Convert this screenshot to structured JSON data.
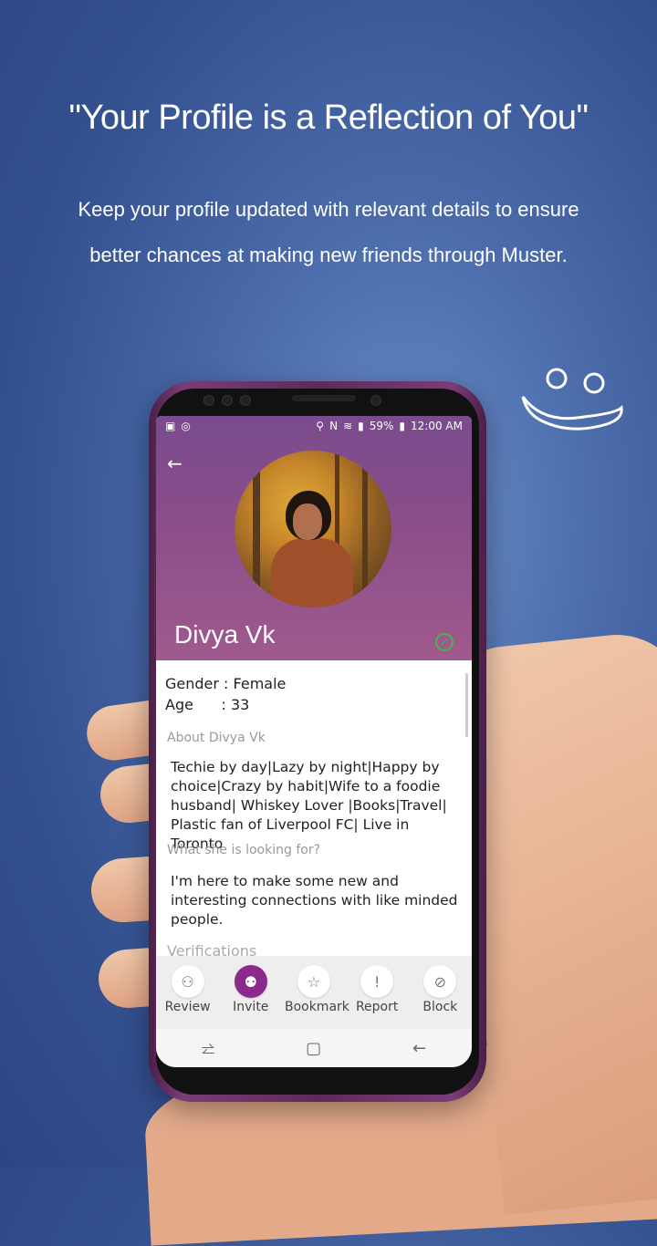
{
  "headline": "\"Your Profile is a Reflection of You\"",
  "subline_1": "Keep your profile updated with relevant details to ensure",
  "subline_2": "better chances at making new friends through Muster.",
  "status": {
    "left_icons": [
      "cast-icon",
      "instagram-icon"
    ],
    "battery": "59%",
    "time": "12:00 AM"
  },
  "profile": {
    "name": "Divya Vk",
    "gender_line": "Gender : Female",
    "age_line": "Age      : 33",
    "about_title": "About Divya Vk",
    "about_text": "Techie by day|Lazy by night|Happy by choice|Crazy by habit|Wife to a foodie husband| Whiskey Lover |Books|Travel| Plastic fan of Liverpool FC| Live in Toronto",
    "looking_title": "What she is looking for?",
    "looking_text": "I'm here to make some new and interesting connections with like minded people.",
    "verifications_title": "Verifications"
  },
  "actions": [
    {
      "label": "Review",
      "icon": "person-add-icon"
    },
    {
      "label": "Invite",
      "icon": "people-icon"
    },
    {
      "label": "Bookmark",
      "icon": "star-icon"
    },
    {
      "label": "Report",
      "icon": "exclamation-icon"
    },
    {
      "label": "Block",
      "icon": "block-icon"
    }
  ],
  "colors": {
    "accent": "#8c2a8c",
    "header_top": "#7a4b8e",
    "background": "#4a6aaa"
  }
}
